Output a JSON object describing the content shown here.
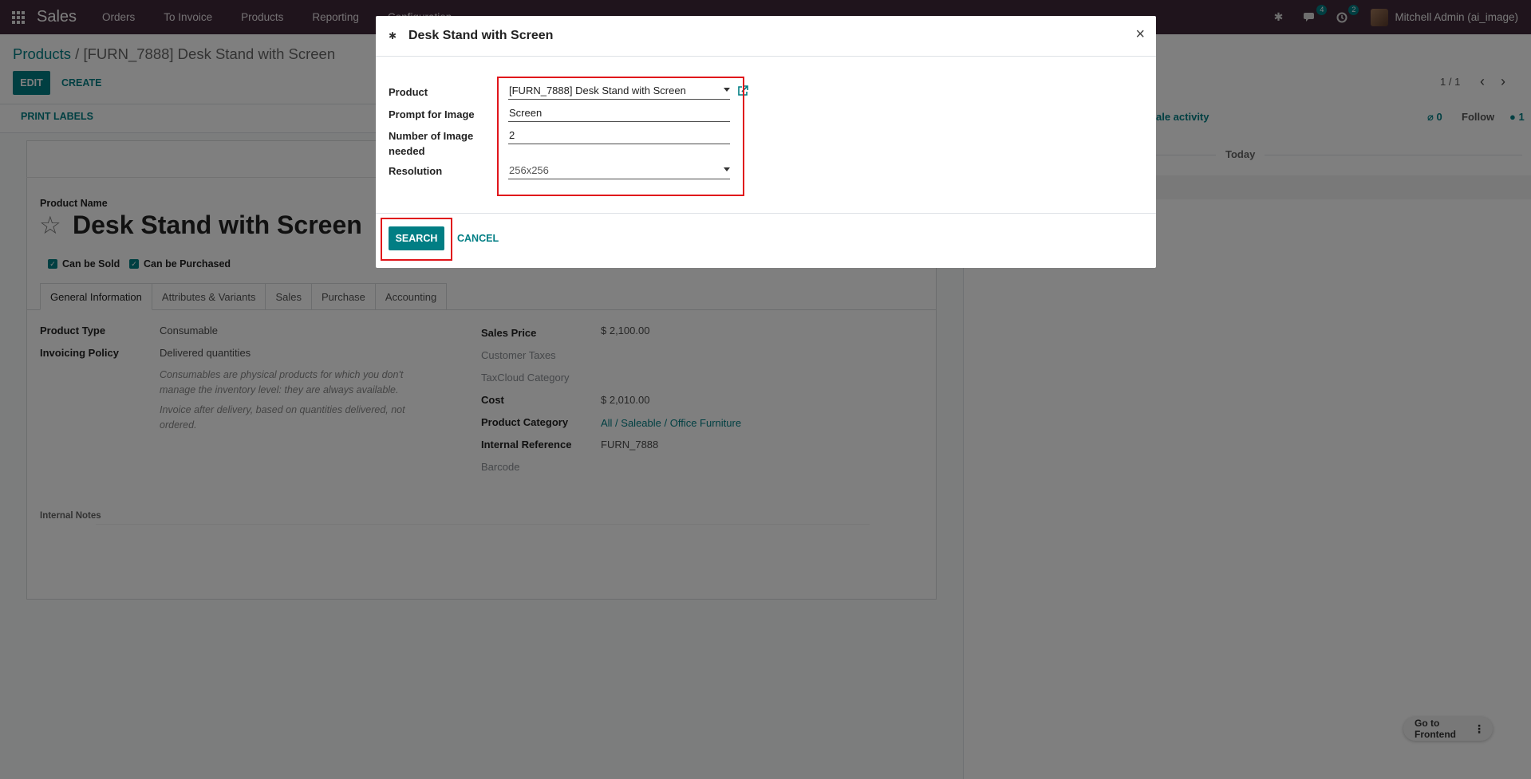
{
  "navbar": {
    "app_name": "Sales",
    "menu": [
      "Orders",
      "To Invoice",
      "Products",
      "Reporting",
      "Configuration"
    ],
    "messages_badge": "4",
    "activities_badge": "2",
    "user": "Mitchell Admin (ai_image)"
  },
  "breadcrumb": {
    "parent": "Products",
    "separator": " / ",
    "current": "[FURN_7888] Desk Stand with Screen"
  },
  "toolbar": {
    "edit_label": "EDIT",
    "create_label": "CREATE",
    "pager": "1 / 1",
    "print_labels": "PRINT LABELS"
  },
  "form": {
    "product_name_label": "Product Name",
    "product_name": "Desk Stand with Screen",
    "can_be_sold": "Can be Sold",
    "can_be_purchased": "Can be Purchased",
    "tabs": [
      "General Information",
      "Attributes & Variants",
      "Sales",
      "Purchase",
      "Accounting"
    ],
    "product_type_label": "Product Type",
    "product_type": "Consumable",
    "invoicing_policy_label": "Invoicing Policy",
    "invoicing_policy": "Delivered quantities",
    "help_consumable": "Consumables are physical products for which you don't manage the inventory level: they are always available.",
    "help_invoice": "Invoice after delivery, based on quantities delivered, not ordered.",
    "sales_price_label": "Sales Price",
    "sales_price": "$ 2,100.00",
    "customer_taxes_label": "Customer Taxes",
    "taxcloud_label": "TaxCloud Category",
    "cost_label": "Cost",
    "cost": "$ 2,010.00",
    "category_label": "Product Category",
    "category": "All / Saleable / Office Furniture",
    "internal_ref_label": "Internal Reference",
    "internal_ref": "FURN_7888",
    "barcode_label": "Barcode",
    "internal_notes_label": "Internal Notes"
  },
  "chatter": {
    "schedule_activity": "ale activity",
    "attachments": "0",
    "follow": "Follow",
    "followers": "1",
    "today": "Today"
  },
  "go_frontend": "Go to Frontend",
  "modal": {
    "title": "Desk Stand with Screen",
    "product_label": "Product",
    "product_value": "[FURN_7888] Desk Stand with Screen",
    "prompt_label": "Prompt for Image",
    "prompt_value": "Screen",
    "count_label_1": "Number of Image",
    "count_label_2": "needed",
    "count_value": "2",
    "resolution_label": "Resolution",
    "resolution_value": "256x256",
    "search_label": "SEARCH",
    "cancel_label": "CANCEL"
  },
  "colors": {
    "brand": "#3f2838",
    "accent": "#017e84",
    "highlight": "#e0151b"
  }
}
